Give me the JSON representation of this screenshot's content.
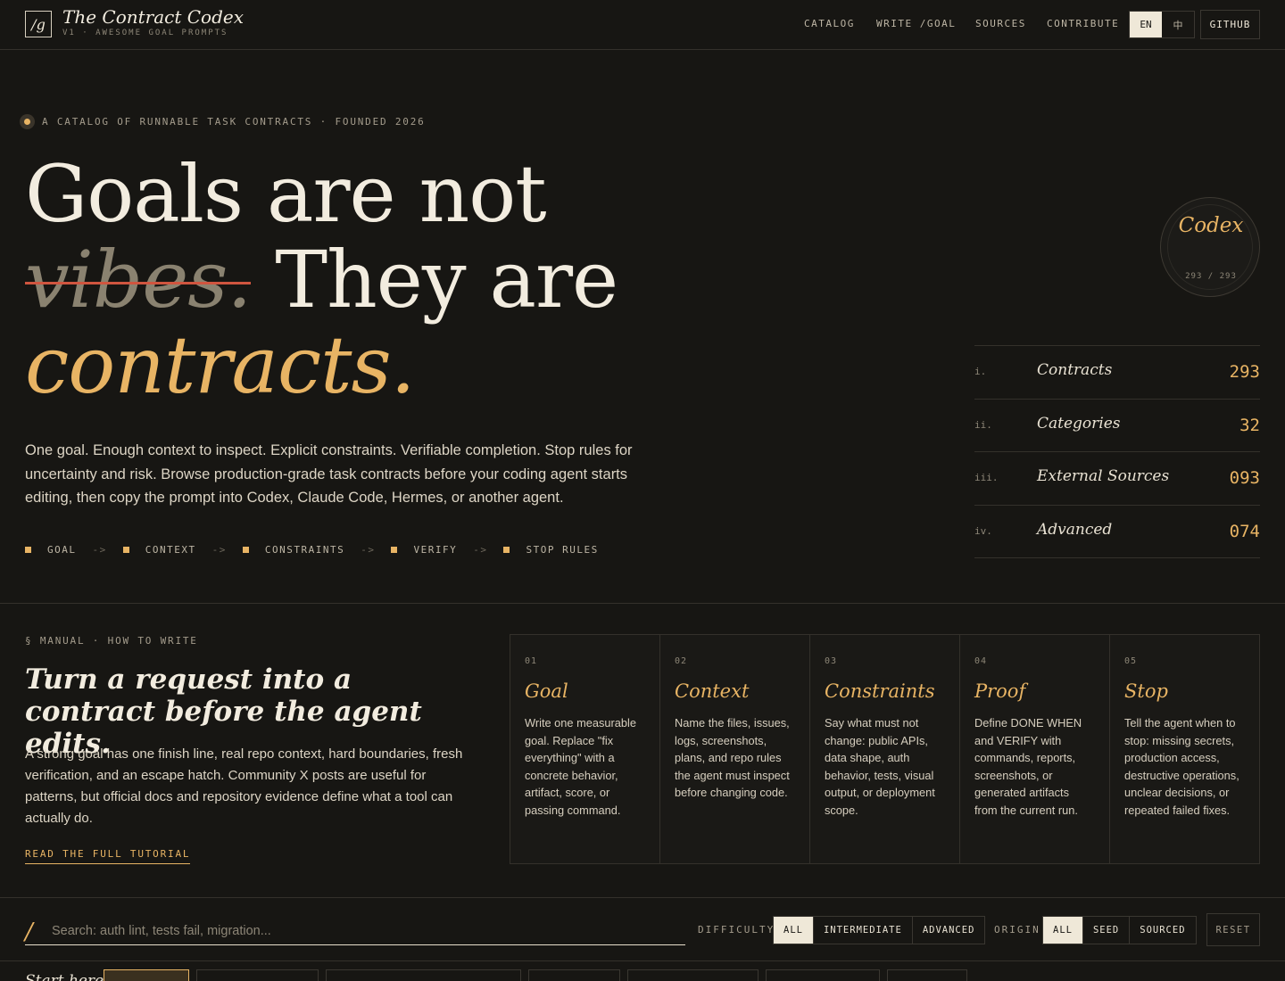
{
  "header": {
    "logo_mark": "/g",
    "title": "The Contract Codex",
    "subtitle": "V1 · AWESOME GOAL PROMPTS",
    "nav": [
      "CATALOG",
      "WRITE /GOAL",
      "SOURCES",
      "CONTRIBUTE"
    ],
    "lang_en": "EN",
    "lang_zh": "中",
    "github": "GITHUB"
  },
  "hero": {
    "eyebrow": "A CATALOG OF RUNNABLE TASK CONTRACTS · FOUNDED 2026",
    "line1": "Goals are not",
    "struck_word": "vibes.",
    "line2_rest": "They are",
    "line3": "contracts.",
    "lead": "One goal. Enough context to inspect. Explicit constraints. Verifiable completion. Stop rules for uncertainty and risk. Browse production-grade task contracts before your coding agent starts editing, then copy the prompt into Codex, Claude Code, Hermes, or another agent.",
    "flow": [
      "GOAL",
      "CONTEXT",
      "CONSTRAINTS",
      "VERIFY",
      "STOP RULES"
    ],
    "flow_arrow": "->"
  },
  "badge": {
    "title": "Codex",
    "count": "293 / 293"
  },
  "stats": [
    {
      "num": "i.",
      "label": "Contracts",
      "value": "293"
    },
    {
      "num": "ii.",
      "label": "Categories",
      "value": "32"
    },
    {
      "num": "iii.",
      "label": "External Sources",
      "value": "093"
    },
    {
      "num": "iv.",
      "label": "Advanced",
      "value": "074"
    }
  ],
  "manual": {
    "eyebrow": "§ MANUAL · HOW TO WRITE",
    "title": "Turn a request into a contract before the agent edits.",
    "body": "A strong goal has one finish line, real repo context, hard boundaries, fresh verification, and an escape hatch. Community X posts are useful for patterns, but official docs and repository evidence define what a tool can actually do.",
    "link": "READ THE FULL TUTORIAL",
    "steps": [
      {
        "no": "01",
        "title": "Goal",
        "desc": "Write one measurable goal. Replace \"fix everything\" with a concrete behavior, artifact, score, or passing command."
      },
      {
        "no": "02",
        "title": "Context",
        "desc": "Name the files, issues, logs, screenshots, plans, and repo rules the agent must inspect before changing code."
      },
      {
        "no": "03",
        "title": "Constraints",
        "desc": "Say what must not change: public APIs, data shape, auth behavior, tests, visual output, or deployment scope."
      },
      {
        "no": "04",
        "title": "Proof",
        "desc": "Define DONE WHEN and VERIFY with commands, reports, screenshots, or generated artifacts from the current run."
      },
      {
        "no": "05",
        "title": "Stop",
        "desc": "Tell the agent when to stop: missing secrets, production access, destructive operations, unclear decisions, or repeated failed fixes."
      }
    ]
  },
  "filters": {
    "search_slash": "/",
    "search_placeholder": "Search: auth lint, tests fail, migration...",
    "difficulty_label": "DIFFICULTY",
    "difficulty_options": [
      "ALL",
      "INTERMEDIATE",
      "ADVANCED"
    ],
    "origin_label": "ORIGIN",
    "origin_options": [
      "ALL",
      "SEED",
      "SOURCED"
    ],
    "reset": "RESET"
  },
  "start_here": {
    "label": "Start here"
  },
  "colors": {
    "background": "#171613",
    "accent": "#e8b464",
    "strike": "#d0553f",
    "text": "#f2ecdf"
  }
}
